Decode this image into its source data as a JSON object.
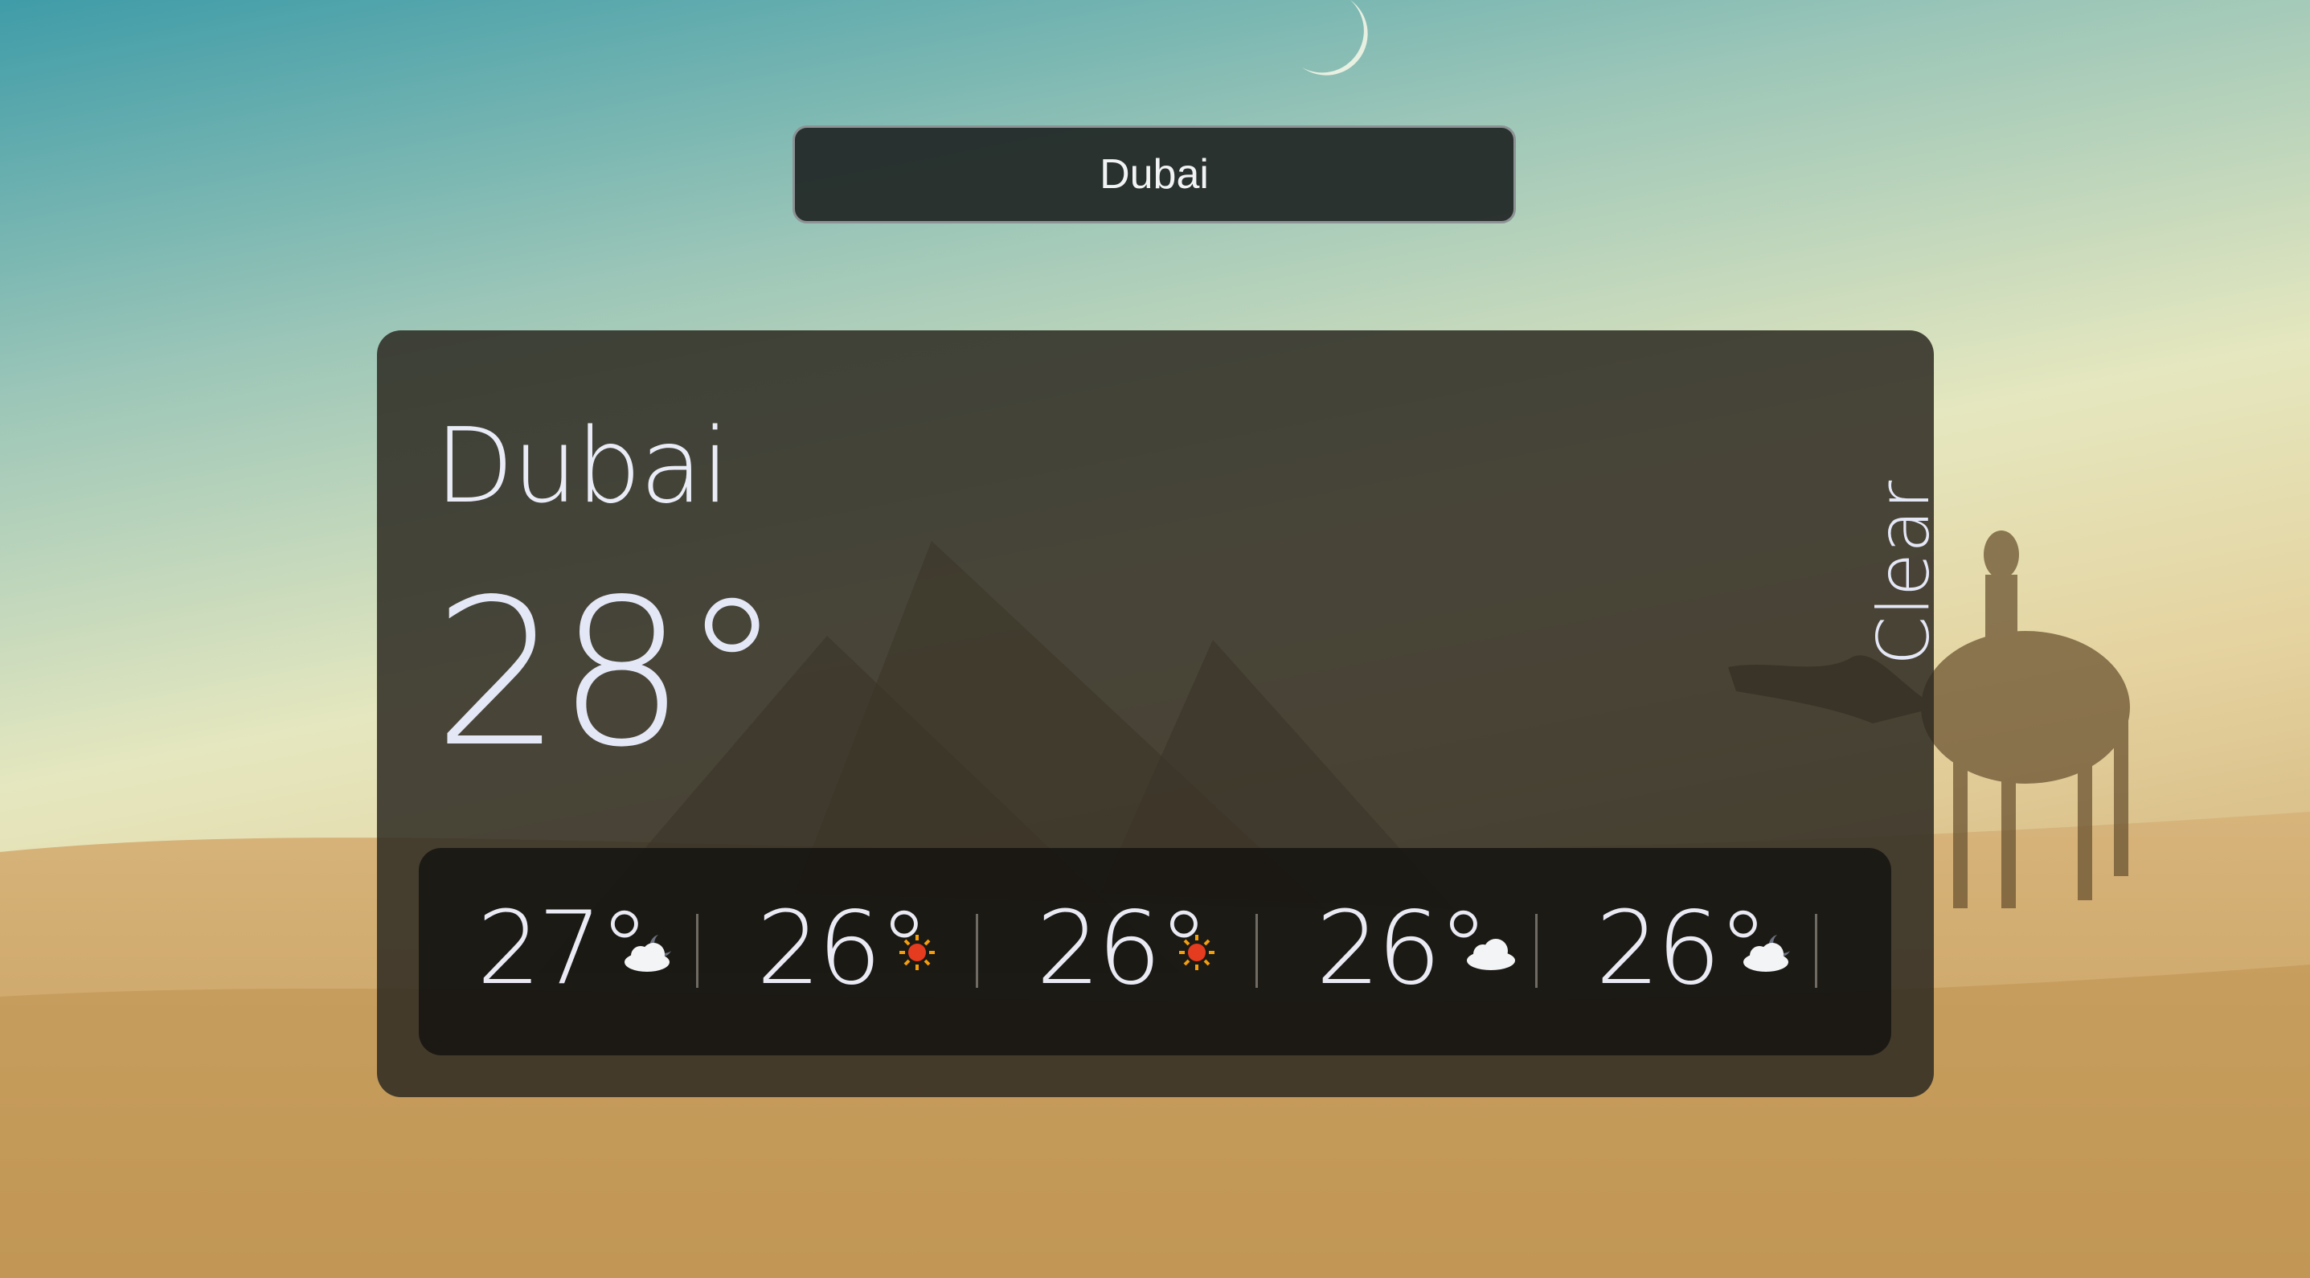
{
  "search": {
    "value": "Dubai"
  },
  "current": {
    "city": "Dubai",
    "temperature": "28°",
    "condition": "Clear"
  },
  "forecast": [
    {
      "temp": "27°",
      "icon": "cloud-moon-icon"
    },
    {
      "temp": "26°",
      "icon": "sun-icon"
    },
    {
      "temp": "26°",
      "icon": "sun-icon"
    },
    {
      "temp": "26°",
      "icon": "cloud-icon"
    },
    {
      "temp": "26°",
      "icon": "cloud-moon-icon"
    }
  ],
  "colors": {
    "text": "#e9ecf6",
    "card": "#2d2a22",
    "sun": "#e53b1e"
  }
}
